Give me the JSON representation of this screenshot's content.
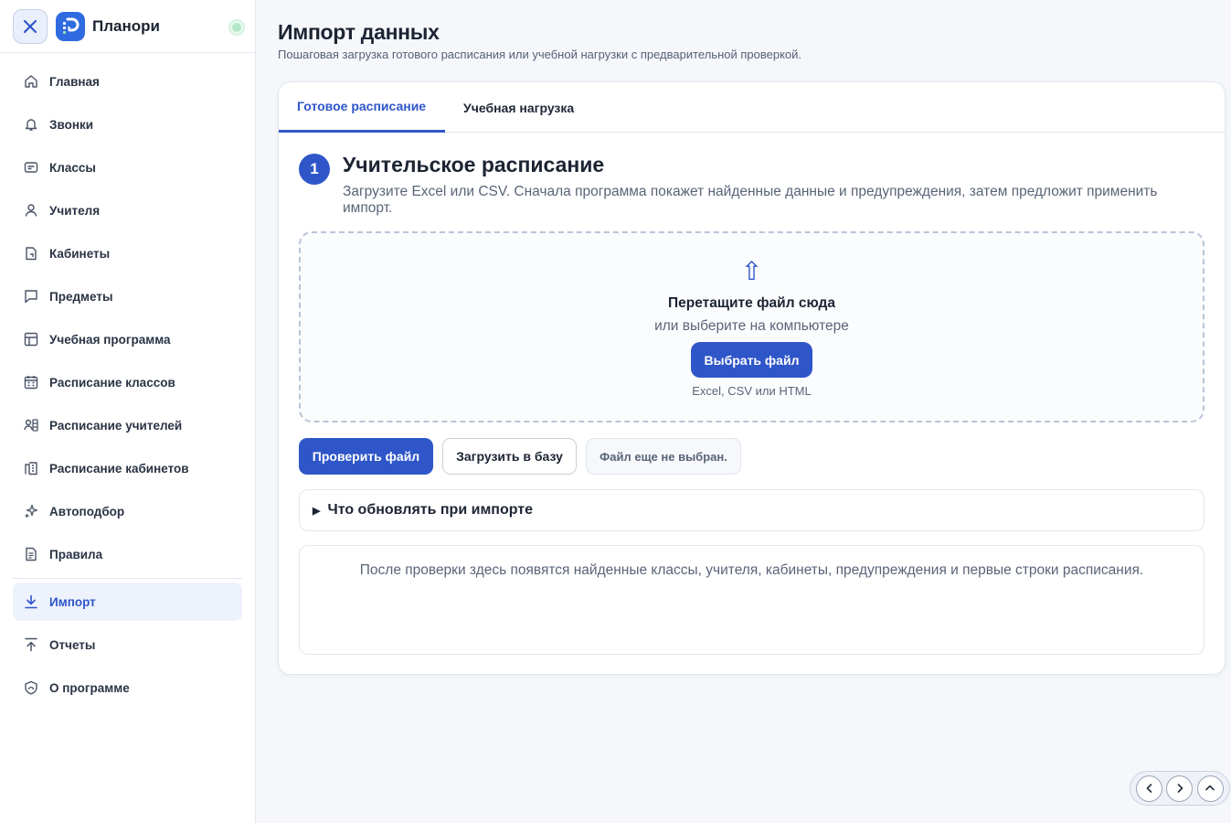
{
  "app": {
    "title": "Планори",
    "close_icon": "close-icon",
    "logo_icon": "planori-logo"
  },
  "sidebar": {
    "items": [
      {
        "label": "Главная",
        "icon": "home-icon"
      },
      {
        "label": "Звонки",
        "icon": "bell-icon"
      },
      {
        "label": "Классы",
        "icon": "class-icon"
      },
      {
        "label": "Учителя",
        "icon": "user-icon"
      },
      {
        "label": "Кабинеты",
        "icon": "door-icon"
      },
      {
        "label": "Предметы",
        "icon": "message-square-icon"
      },
      {
        "label": "Учебная программа",
        "icon": "table-icon"
      },
      {
        "label": "Расписание классов",
        "icon": "calendar-icon"
      },
      {
        "label": "Расписание учителей",
        "icon": "users-schedule-icon"
      },
      {
        "label": "Расписание кабинетов",
        "icon": "building-icon"
      },
      {
        "label": "Автоподбор",
        "icon": "sparkles-icon"
      },
      {
        "label": "Правила",
        "icon": "file-text-icon"
      },
      {
        "label": "Импорт",
        "icon": "download-icon",
        "active": true
      },
      {
        "label": "Отчеты",
        "icon": "upload-icon"
      },
      {
        "label": "О программе",
        "icon": "shield-icon"
      }
    ]
  },
  "header": {
    "title": "Импорт данных",
    "subtitle": "Пошаговая загрузка готового расписания или учебной нагрузки с предварительной проверкой."
  },
  "tabs": [
    {
      "label": "Готовое расписание",
      "active": true
    },
    {
      "label": "Учебная нагрузка",
      "active": false
    }
  ],
  "step": {
    "number": "1",
    "title": "Учительское расписание",
    "description": "Загрузите Excel или CSV. Сначала программа покажет найденные данные и предупреждения, затем предложит применить импорт."
  },
  "dropzone": {
    "icon": "upload-arrow-icon",
    "title": "Перетащите файл сюда",
    "subtitle": "или выберите на компьютере",
    "button_label": "Выбрать файл",
    "hint": "Excel, CSV или HTML"
  },
  "actions": {
    "check_label": "Проверить файл",
    "load_label": "Загрузить в базу",
    "status_text": "Файл еще не выбран."
  },
  "details": {
    "summary": "Что обновлять при импорте"
  },
  "preview": {
    "placeholder": "После проверки здесь появятся найденные классы, учителя, кабинеты, предупреждения и первые строки расписания."
  },
  "colors": {
    "accent": "#2f56c9",
    "logo": "#2f6be0",
    "active_bg": "#eef2fc"
  }
}
